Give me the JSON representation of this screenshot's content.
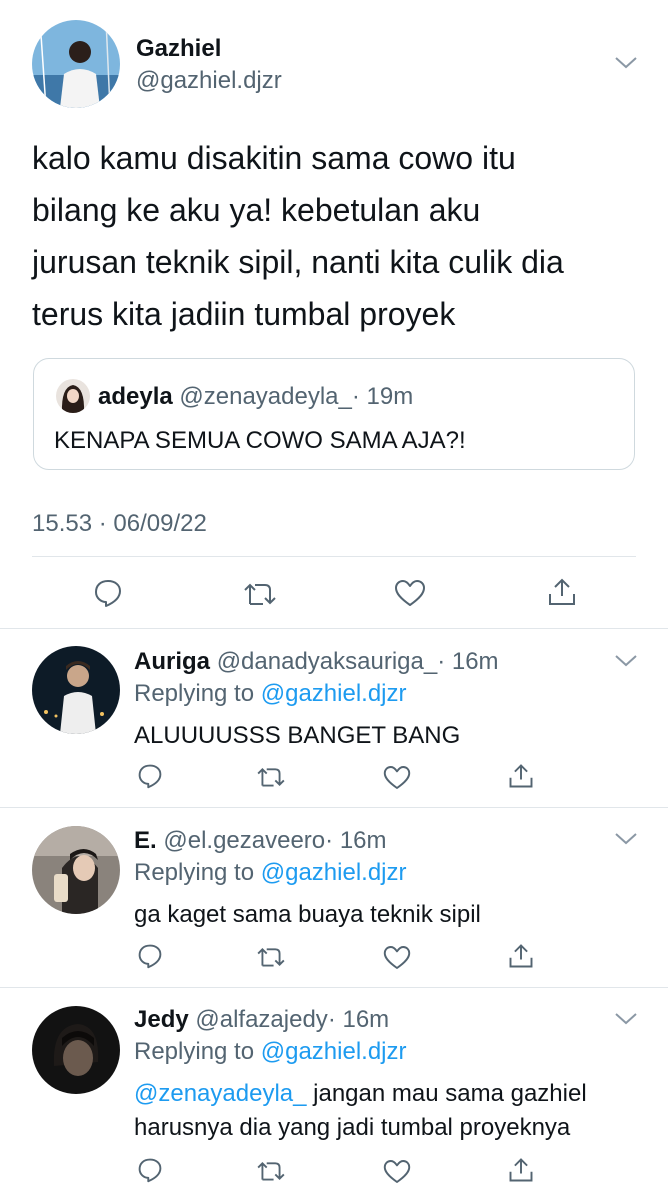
{
  "main_tweet": {
    "author_name": "Gazhiel",
    "author_handle": "@gazhiel.djzr",
    "text_lines": [
      "kalo kamu disakitin sama cowo itu",
      "bilang ke aku ya! kebetulan aku",
      "jurusan teknik sipil, nanti kita culik dia",
      "terus kita jadiin tumbal proyek"
    ],
    "quoted": {
      "author_name": "adeyla",
      "author_handle": "@zenayadeyla_",
      "time": "· 19m",
      "text": "KENAPA SEMUA COWO SAMA AJA?!"
    },
    "timestamp": "15.53 · 06/09/22"
  },
  "replies": [
    {
      "author_name": "Auriga",
      "author_handle": "@danadyaksauriga_",
      "time": "· 16m",
      "replying_prefix": "Replying to",
      "replying_handle": "@gazhiel.djzr",
      "text": "ALUUUUSSS BANGET BANG"
    },
    {
      "author_name": "E.",
      "author_handle": "@el.gezaveero",
      "time": "· 16m",
      "replying_prefix": "Replying to",
      "replying_handle": "@gazhiel.djzr",
      "text": "ga kaget sama buaya teknik sipil"
    },
    {
      "author_name": "Jedy",
      "author_handle": "@alfazajedy",
      "time": "· 16m",
      "replying_prefix": "Replying to",
      "replying_handle": "@gazhiel.djzr",
      "mention": "@zenayadeyla_",
      "text_line1": "jangan mau sama gazhiel",
      "text_line2": "harusnya dia yang jadi tumbal proyeknya"
    }
  ],
  "icons": [
    "chevron-down-icon",
    "reply-icon",
    "retweet-icon",
    "like-icon",
    "share-icon"
  ],
  "colors": {
    "text": "#0f1419",
    "secondary": "#536471",
    "link": "#1d9bf0",
    "divider": "#e1e6ea"
  }
}
